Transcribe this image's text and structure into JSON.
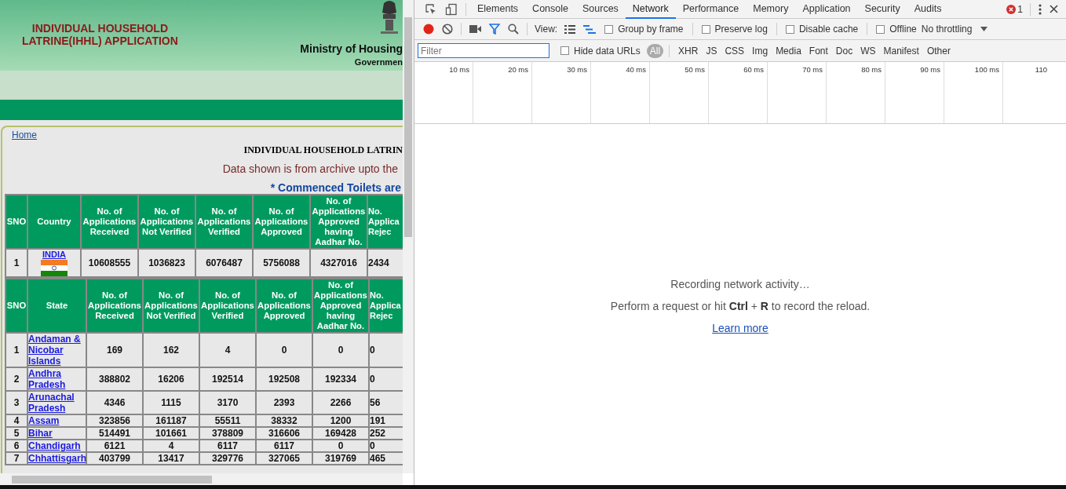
{
  "site": {
    "title": "INDIVIDUAL HOUSEHOLD\nLATRINE(IHHL) APPLICATION",
    "ministry": "Ministry of Housing",
    "government": "Governmen",
    "breadcrumb": "Home",
    "report_title": "INDIVIDUAL HOUSEHOLD LATRIN",
    "archive_note": "Data shown is from archive upto the",
    "commenced_note": "* Commenced Toilets are"
  },
  "country_table": {
    "columns": [
      "SNO",
      "Country",
      "No. of\nApplications\nReceived",
      "No. of\nApplications\nNot Verified",
      "No. of\nApplications\nVerified",
      "No. of\nApplications\nApproved",
      "No. of\nApplications\nApproved\nhaving\nAadhar No.",
      "No.\nApplica\nRejec"
    ],
    "rows": [
      {
        "sno": "1",
        "name": "INDIA",
        "values": [
          "10608555",
          "1036823",
          "6076487",
          "5756088",
          "4327016",
          "2434"
        ]
      }
    ]
  },
  "state_table": {
    "columns": [
      "SNO",
      "State",
      "No. of\nApplications\nReceived",
      "No. of\nApplications\nNot Verified",
      "No. of\nApplications\nVerified",
      "No. of\nApplications\nApproved",
      "No. of\nApplications\nApproved\nhaving\nAadhar No.",
      "No.\nApplica\nRejec"
    ],
    "rows": [
      {
        "sno": "1",
        "name": "Andaman &\nNicobar\nIslands",
        "values": [
          "169",
          "162",
          "4",
          "0",
          "0",
          "0"
        ]
      },
      {
        "sno": "2",
        "name": "Andhra\nPradesh",
        "values": [
          "388802",
          "16206",
          "192514",
          "192508",
          "192334",
          "0"
        ]
      },
      {
        "sno": "3",
        "name": "Arunachal\nPradesh",
        "values": [
          "4346",
          "1115",
          "3170",
          "2393",
          "2266",
          "56"
        ]
      },
      {
        "sno": "4",
        "name": "Assam",
        "values": [
          "323856",
          "161187",
          "55511",
          "38332",
          "1200",
          "191"
        ]
      },
      {
        "sno": "5",
        "name": "Bihar",
        "values": [
          "514491",
          "101661",
          "378809",
          "316606",
          "169428",
          "252"
        ]
      },
      {
        "sno": "6",
        "name": "Chandigarh",
        "values": [
          "6121",
          "4",
          "6117",
          "6117",
          "0",
          "0"
        ]
      },
      {
        "sno": "7",
        "name": "Chhattisgarh",
        "values": [
          "403799",
          "13417",
          "329776",
          "327065",
          "319769",
          "465"
        ]
      }
    ]
  },
  "devtools": {
    "tabs": [
      {
        "label": "Elements",
        "selected": false
      },
      {
        "label": "Console",
        "selected": false
      },
      {
        "label": "Sources",
        "selected": false
      },
      {
        "label": "Network",
        "selected": true
      },
      {
        "label": "Performance",
        "selected": false
      },
      {
        "label": "Memory",
        "selected": false
      },
      {
        "label": "Application",
        "selected": false
      },
      {
        "label": "Security",
        "selected": false
      },
      {
        "label": "Audits",
        "selected": false
      }
    ],
    "error_count": "1",
    "view_label": "View:",
    "options": [
      {
        "label": "Group by frame",
        "checked": false
      },
      {
        "label": "Preserve log",
        "checked": false
      },
      {
        "label": "Disable cache",
        "checked": false
      },
      {
        "label": "Offline",
        "checked": false
      }
    ],
    "throttling": "No throttling",
    "filter": {
      "placeholder": "Filter"
    },
    "hide_data_urls": {
      "label": "Hide data URLs",
      "checked": false
    },
    "types": [
      {
        "label": "All",
        "selected": true
      },
      {
        "label": "XHR",
        "selected": false
      },
      {
        "label": "JS",
        "selected": false
      },
      {
        "label": "CSS",
        "selected": false
      },
      {
        "label": "Img",
        "selected": false
      },
      {
        "label": "Media",
        "selected": false
      },
      {
        "label": "Font",
        "selected": false
      },
      {
        "label": "Doc",
        "selected": false
      },
      {
        "label": "WS",
        "selected": false
      },
      {
        "label": "Manifest",
        "selected": false
      },
      {
        "label": "Other",
        "selected": false
      }
    ],
    "ticks": [
      "10 ms",
      "20 ms",
      "30 ms",
      "40 ms",
      "50 ms",
      "60 ms",
      "70 ms",
      "80 ms",
      "90 ms",
      "100 ms",
      "110"
    ],
    "recording": "Recording network activity…",
    "hint_before": "Perform a request or hit",
    "hint_key1": "Ctrl",
    "hint_plus": "+",
    "hint_key2": "R",
    "hint_after": "to record the reload.",
    "learn_more": "Learn more"
  }
}
